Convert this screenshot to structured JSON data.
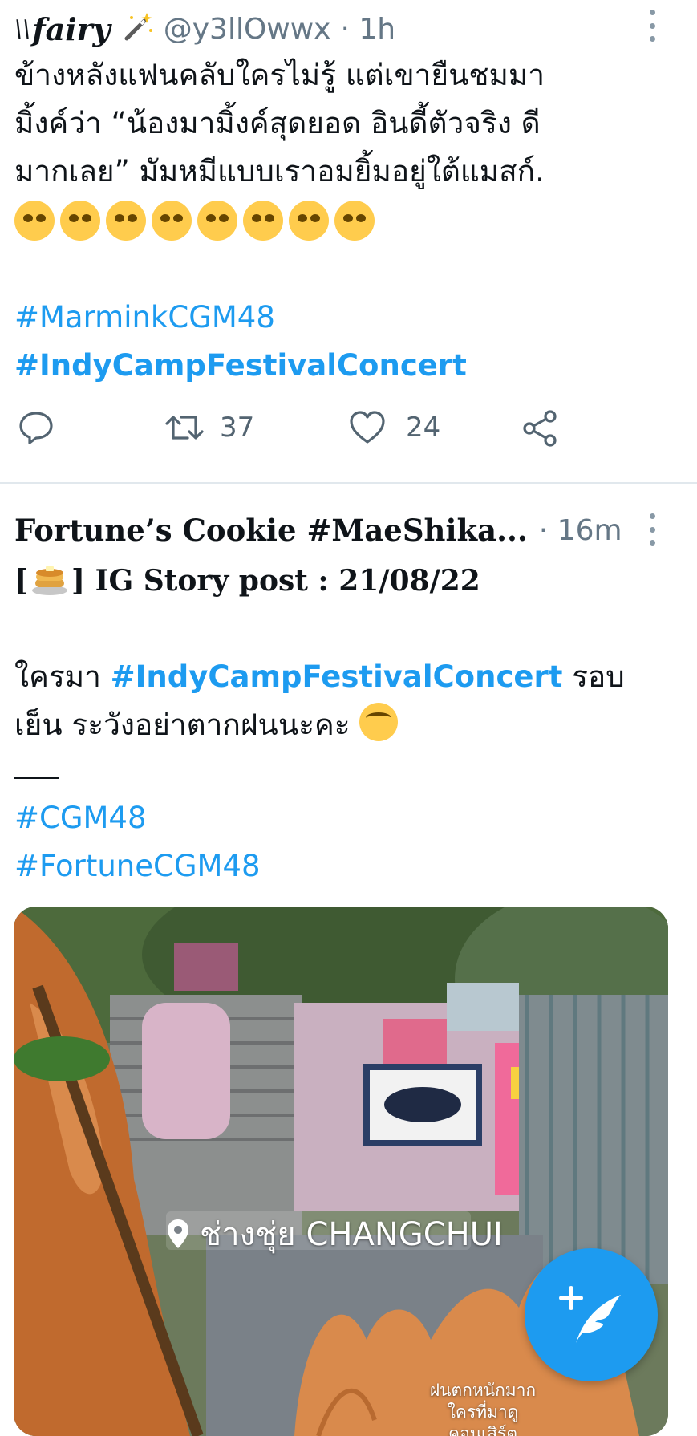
{
  "tweets": [
    {
      "display_name": "fairy",
      "handle": "@y3llOwwx",
      "time": "· 1h",
      "text_lines": [
        "ข้างหลังแฟนคลับใครไม่รู้ แต่เขายืนชมมา",
        "มิ้งค์ว่า “น้องมามิ้งค์สุดยอด อินดี้ตัวจริง ดี",
        "มากเลย” มัมหมีแบบเราอมยิ้มอยู่ใต้แมสก์."
      ],
      "emoji_count": 8,
      "hashtags": [
        "#MarminkCGM48",
        "#IndyCampFestivalConcert"
      ],
      "retweets": "37",
      "likes": "24"
    },
    {
      "display_name": "Fortune’s Cookie #MaeShika...",
      "time": "· 16m",
      "line1": "] IG Story post : 21/08/22",
      "line1_prefix": "[",
      "line2_prefix": "ใครมา ",
      "line2_hashtag": "#IndyCampFestivalConcert",
      "line2_suffix": " รอบ",
      "line3": "เย็น ระวังอย่าตากฝนนะคะ ",
      "separator": "___",
      "hashtags": [
        "#CGM48",
        "#FortuneCGM48"
      ],
      "media": {
        "location": "ช่างชุ่ย CHANGCHUI",
        "caption_line1": "ฝนตกหนักมาก",
        "caption_line2": "ใครที่มาดูคอนเสิร์ต"
      }
    }
  ],
  "colors": {
    "accent": "#1d9bf0",
    "text": "#0f1419",
    "secondary": "#657786",
    "divider": "#e1e8ed"
  },
  "icons": [
    "reply-icon",
    "retweet-icon",
    "like-icon",
    "share-icon",
    "more-icon",
    "compose-icon",
    "location-pin-icon"
  ]
}
